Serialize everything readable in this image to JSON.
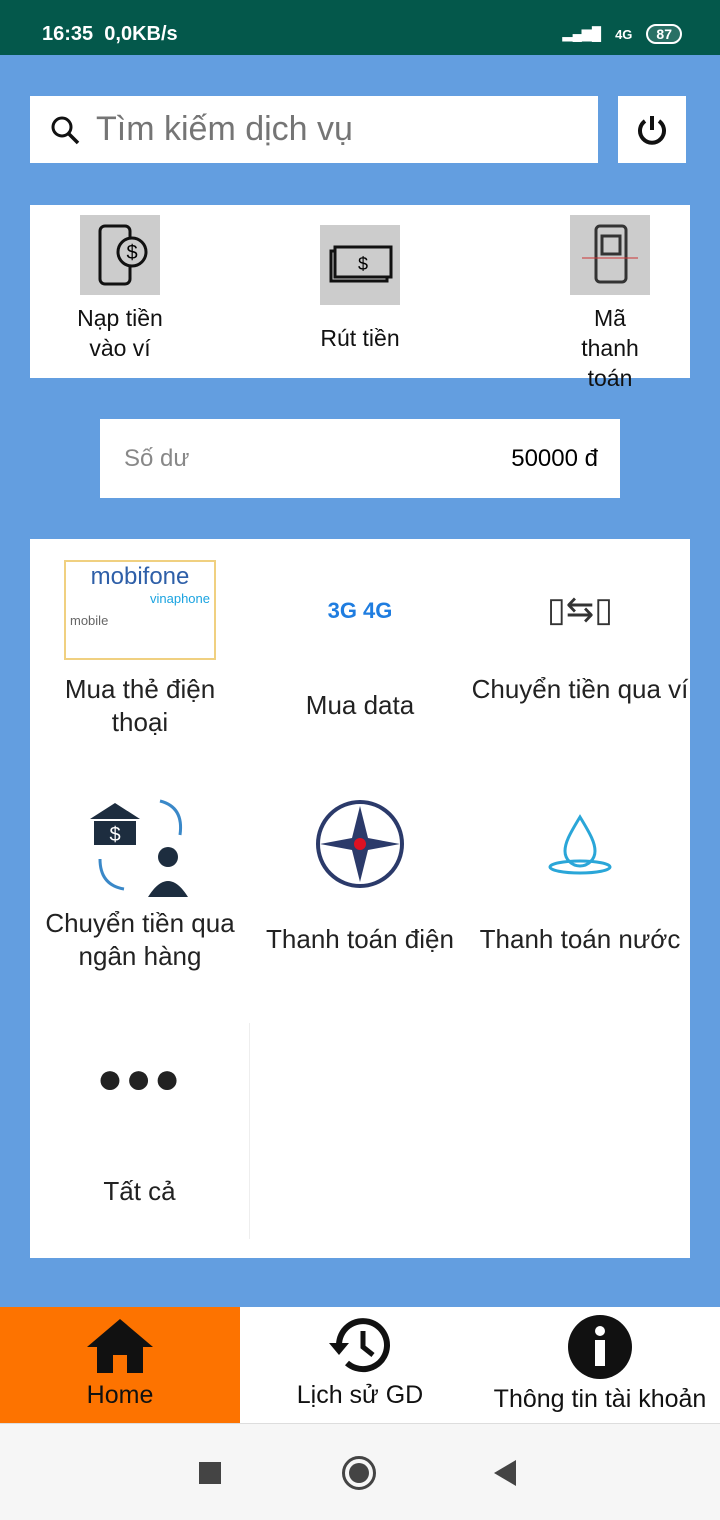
{
  "status": {
    "time": "16:35",
    "speed": "0,0KB/s",
    "network": "4G",
    "battery": "87"
  },
  "search": {
    "placeholder": "Tìm kiếm dịch vụ"
  },
  "quick_actions": [
    {
      "label": "Nạp tiền vào ví"
    },
    {
      "label": "Rút tiền"
    },
    {
      "label": "Mã thanh toán"
    }
  ],
  "balance": {
    "label": "Số dư",
    "value": "50000 đ"
  },
  "services": [
    {
      "label": "Mua thẻ điện thoại"
    },
    {
      "label": "Mua data"
    },
    {
      "label": "Chuyển tiền qua ví"
    },
    {
      "label": "Chuyển tiền qua ngân hàng"
    },
    {
      "label": "Thanh toán điện"
    },
    {
      "label": "Thanh toán nước"
    },
    {
      "label": "Tất cả"
    }
  ],
  "logos": {
    "mobifone": "mobifone",
    "vinaphone": "vinaphone",
    "mobile": "mobile",
    "data": "3G 4G"
  },
  "nav": [
    {
      "label": "Home"
    },
    {
      "label": "Lịch sử GD"
    },
    {
      "label": "Thông tin tài khoản"
    }
  ],
  "colors": {
    "accent": "#fd7300",
    "background": "#639ee0",
    "status": "#04584b"
  }
}
